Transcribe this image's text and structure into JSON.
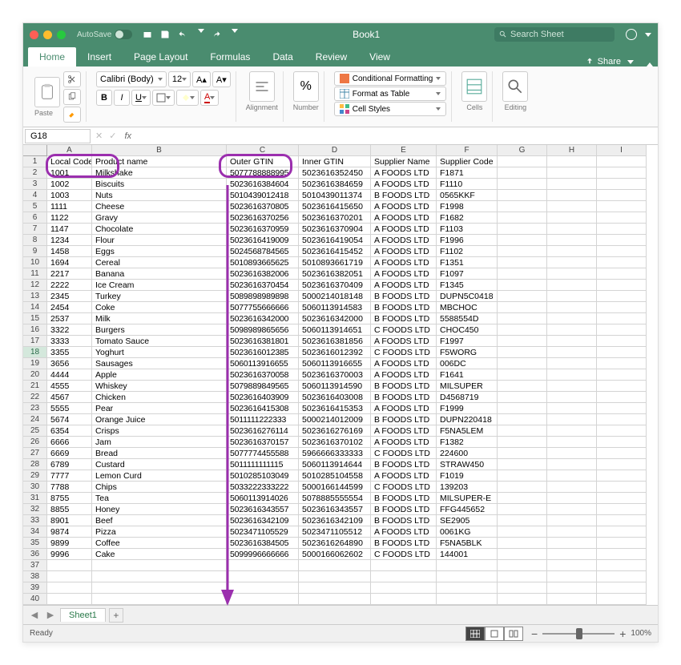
{
  "titlebar": {
    "autosave_label": "AutoSave",
    "title": "Book1",
    "search_placeholder": "Search Sheet"
  },
  "tabs": [
    "Home",
    "Insert",
    "Page Layout",
    "Formulas",
    "Data",
    "Review",
    "View"
  ],
  "active_tab": "Home",
  "share_label": "Share",
  "ribbon": {
    "paste_label": "Paste",
    "font_name": "Calibri (Body)",
    "font_size": "12",
    "alignment_label": "Alignment",
    "number_label": "Number",
    "cond_fmt": "Conditional Formatting",
    "fmt_table": "Format as Table",
    "cell_styles": "Cell Styles",
    "cells_label": "Cells",
    "editing_label": "Editing"
  },
  "name_box": "G18",
  "formula_value": "",
  "columns": [
    "A",
    "B",
    "C",
    "D",
    "E",
    "F",
    "G",
    "H",
    "I"
  ],
  "headers": [
    "Local Code",
    "Product name",
    "Outer GTIN",
    "Inner GTIN",
    "Supplier Name",
    "Supplier Code"
  ],
  "rows": [
    {
      "n": 2,
      "a": "1001",
      "b": "Milkshake",
      "c": "5077788888995",
      "d": "5023616352450",
      "e": "A FOODS LTD",
      "f": "F1871"
    },
    {
      "n": 3,
      "a": "1002",
      "b": "Biscuits",
      "c": "5023616384604",
      "d": "5023616384659",
      "e": "A FOODS LTD",
      "f": "F1110"
    },
    {
      "n": 4,
      "a": "1003",
      "b": "Nuts",
      "c": "5010439012418",
      "d": "5010439011374",
      "e": "B FOODS LTD",
      "f": "0565KKF"
    },
    {
      "n": 5,
      "a": "1111",
      "b": "Cheese",
      "c": "5023616370805",
      "d": "5023616415650",
      "e": "A FOODS LTD",
      "f": "F1998"
    },
    {
      "n": 6,
      "a": "1122",
      "b": "Gravy",
      "c": "5023616370256",
      "d": "5023616370201",
      "e": "A FOODS LTD",
      "f": "F1682"
    },
    {
      "n": 7,
      "a": "1147",
      "b": "Chocolate",
      "c": "5023616370959",
      "d": "5023616370904",
      "e": "A FOODS LTD",
      "f": "F1103"
    },
    {
      "n": 8,
      "a": "1234",
      "b": "Flour",
      "c": "5023616419009",
      "d": "5023616419054",
      "e": "A FOODS LTD",
      "f": "F1996"
    },
    {
      "n": 9,
      "a": "1458",
      "b": "Eggs",
      "c": "5024568784565",
      "d": "5023616415452",
      "e": "A FOODS LTD",
      "f": "F1102"
    },
    {
      "n": 10,
      "a": "1694",
      "b": "Cereal",
      "c": "5010893665625",
      "d": "5010893661719",
      "e": "A FOODS LTD",
      "f": "F1351"
    },
    {
      "n": 11,
      "a": "2217",
      "b": "Banana",
      "c": "5023616382006",
      "d": "5023616382051",
      "e": "A FOODS LTD",
      "f": "F1097"
    },
    {
      "n": 12,
      "a": "2222",
      "b": "Ice Cream",
      "c": "5023616370454",
      "d": "5023616370409",
      "e": "A FOODS LTD",
      "f": "F1345"
    },
    {
      "n": 13,
      "a": "2345",
      "b": "Turkey",
      "c": "5089898989898",
      "d": "5000214018148",
      "e": "B FOODS LTD",
      "f": "DUPN5C0418"
    },
    {
      "n": 14,
      "a": "2454",
      "b": "Coke",
      "c": "5077755666666",
      "d": "5060113914583",
      "e": "B FOODS LTD",
      "f": "MBCHOC"
    },
    {
      "n": 15,
      "a": "2537",
      "b": "Milk",
      "c": "5023616342000",
      "d": "5023616342000",
      "e": "B FOODS LTD",
      "f": "5588554D"
    },
    {
      "n": 16,
      "a": "3322",
      "b": "Burgers",
      "c": "5098989865656",
      "d": "5060113914651",
      "e": "C FOODS LTD",
      "f": "CHOC450"
    },
    {
      "n": 17,
      "a": "3333",
      "b": "Tomato Sauce",
      "c": "5023616381801",
      "d": "5023616381856",
      "e": "A FOODS LTD",
      "f": "F1997"
    },
    {
      "n": 18,
      "a": "3355",
      "b": "Yoghurt",
      "c": "5023616012385",
      "d": "5023616012392",
      "e": "C FOODS LTD",
      "f": "F5WORG"
    },
    {
      "n": 19,
      "a": "3656",
      "b": "Sausages",
      "c": "5060113916655",
      "d": "5060113916655",
      "e": "A FOODS LTD",
      "f": "006DC"
    },
    {
      "n": 20,
      "a": "4444",
      "b": "Apple",
      "c": "5023616370058",
      "d": "5023616370003",
      "e": "A FOODS LTD",
      "f": "F1641"
    },
    {
      "n": 21,
      "a": "4555",
      "b": "Whiskey",
      "c": "5079889849565",
      "d": "5060113914590",
      "e": "B FOODS LTD",
      "f": "MILSUPER"
    },
    {
      "n": 22,
      "a": "4567",
      "b": "Chicken",
      "c": "5023616403909",
      "d": "5023616403008",
      "e": "B FOODS LTD",
      "f": "D4568719"
    },
    {
      "n": 23,
      "a": "5555",
      "b": "Pear",
      "c": "5023616415308",
      "d": "5023616415353",
      "e": "A FOODS LTD",
      "f": "F1999"
    },
    {
      "n": 24,
      "a": "5674",
      "b": "Orange Juice",
      "c": "5011111222333",
      "d": "5000214012009",
      "e": "B FOODS LTD",
      "f": "DUPN220418"
    },
    {
      "n": 25,
      "a": "6354",
      "b": "Crisps",
      "c": "5023616276114",
      "d": "5023616276169",
      "e": "A FOODS LTD",
      "f": "F5NA5LEM"
    },
    {
      "n": 26,
      "a": "6666",
      "b": "Jam",
      "c": "5023616370157",
      "d": "5023616370102",
      "e": "A FOODS LTD",
      "f": "F1382"
    },
    {
      "n": 27,
      "a": "6669",
      "b": "Bread",
      "c": "5077774455588",
      "d": "5966666333333",
      "e": "C FOODS LTD",
      "f": "224600"
    },
    {
      "n": 28,
      "a": "6789",
      "b": "Custard",
      "c": "5011111111115",
      "d": "5060113914644",
      "e": "B FOODS LTD",
      "f": "STRAW450"
    },
    {
      "n": 29,
      "a": "7777",
      "b": "Lemon Curd",
      "c": "5010285103049",
      "d": "5010285104558",
      "e": "A FOODS LTD",
      "f": "F1019"
    },
    {
      "n": 30,
      "a": "7788",
      "b": "Chips",
      "c": "5033222333222",
      "d": "5000166144599",
      "e": "C FOODS LTD",
      "f": "139203"
    },
    {
      "n": 31,
      "a": "8755",
      "b": "Tea",
      "c": "5060113914026",
      "d": "5078885555554",
      "e": "B FOODS LTD",
      "f": "MILSUPER-E"
    },
    {
      "n": 32,
      "a": "8855",
      "b": "Honey",
      "c": "5023616343557",
      "d": "5023616343557",
      "e": "B FOODS LTD",
      "f": "FFG445652"
    },
    {
      "n": 33,
      "a": "8901",
      "b": "Beef",
      "c": "5023616342109",
      "d": "5023616342109",
      "e": "B FOODS LTD",
      "f": "SE2905"
    },
    {
      "n": 34,
      "a": "9874",
      "b": "Pizza",
      "c": "5023471105529",
      "d": "5023471105512",
      "e": "A FOODS LTD",
      "f": "0061KG"
    },
    {
      "n": 35,
      "a": "9899",
      "b": "Coffee",
      "c": "5023616384505",
      "d": "5023616264890",
      "e": "B FOODS LTD",
      "f": "F5NA5BLK"
    },
    {
      "n": 36,
      "a": "9996",
      "b": "Cake",
      "c": "5099996666666",
      "d": "5000166062602",
      "e": "C FOODS LTD",
      "f": "144001"
    }
  ],
  "empty_rows": [
    37,
    38,
    39,
    40
  ],
  "sheet_tab": "Sheet1",
  "status_text": "Ready",
  "zoom_pct": "100%"
}
